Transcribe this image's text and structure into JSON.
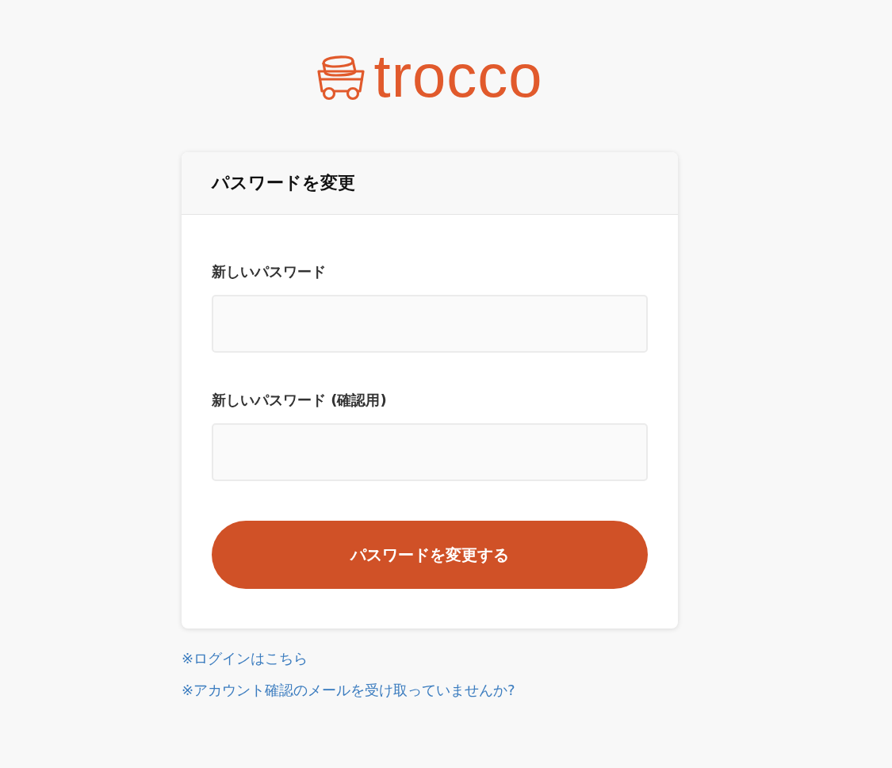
{
  "logo": {
    "text": "trocco"
  },
  "card": {
    "title": "パスワードを変更"
  },
  "fields": [
    {
      "label": "新しいパスワード"
    },
    {
      "label": "新しいパスワード (確認用)"
    }
  ],
  "submit_button": {
    "label": "パスワードを変更する"
  },
  "links": [
    {
      "text": "※ログインはこちら"
    },
    {
      "text": "※アカウント確認のメールを受け取っていませんか?"
    }
  ]
}
